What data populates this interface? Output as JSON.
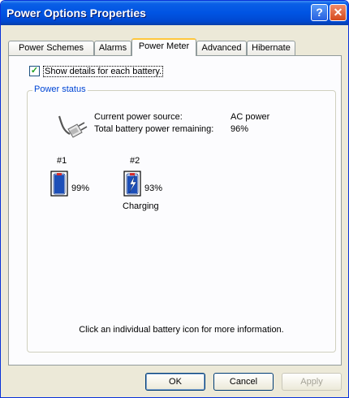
{
  "window": {
    "title": "Power Options Properties",
    "help_glyph": "?",
    "close_glyph": "✕"
  },
  "tabs": [
    {
      "label": "Power Schemes"
    },
    {
      "label": "Alarms"
    },
    {
      "label": "Power Meter",
      "active": true
    },
    {
      "label": "Advanced"
    },
    {
      "label": "Hibernate"
    }
  ],
  "show_details": {
    "checked": true,
    "check_glyph": "✓",
    "label": "Show details for each battery."
  },
  "power_status": {
    "legend": "Power status",
    "source_label": "Current power source:",
    "source_value": "AC power",
    "remaining_label": "Total battery power remaining:",
    "remaining_value": "96%",
    "plug_icon": "ac-plug-icon"
  },
  "batteries": [
    {
      "number": "#1",
      "percent": "99%",
      "level": 0.99,
      "status": "",
      "icon": "battery-icon"
    },
    {
      "number": "#2",
      "percent": "93%",
      "level": 0.93,
      "status": "Charging",
      "icon": "battery-charging-icon"
    }
  ],
  "hint": "Click an individual battery icon for more information.",
  "buttons": {
    "ok": "OK",
    "cancel": "Cancel",
    "apply": "Apply"
  },
  "colors": {
    "title_bar": "#0054e3",
    "active_tab_accent": "#ffc73c",
    "group_legend": "#0046d5",
    "battery_fill": "#1d4fb8",
    "battery_cap": "#d62b2b"
  }
}
